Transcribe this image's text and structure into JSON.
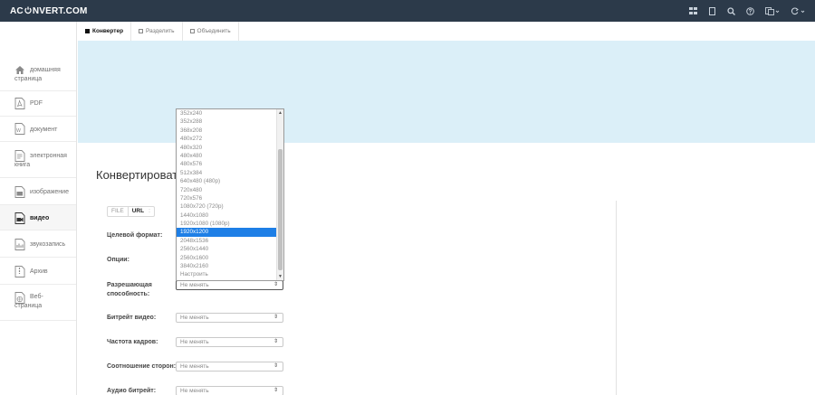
{
  "brand": {
    "text_before": "AC",
    "text_after": "NVERT.COM"
  },
  "topbar": {
    "icons": [
      {
        "name": "apps-grid-icon"
      },
      {
        "name": "bookmark-icon"
      },
      {
        "name": "search-icon"
      },
      {
        "name": "help-icon"
      },
      {
        "name": "language-icon"
      },
      {
        "name": "refresh-icon"
      }
    ]
  },
  "sidebar": {
    "items": [
      {
        "id": "home",
        "label_line1": "домашняя",
        "label_line2": "страница",
        "icon": "home-icon"
      },
      {
        "id": "pdf",
        "label_line1": "PDF",
        "icon": "pdf-icon"
      },
      {
        "id": "document",
        "label_line1": "документ",
        "icon": "document-icon"
      },
      {
        "id": "ebook",
        "label_line1": "электронная",
        "label_line2": "книга",
        "icon": "ebook-icon"
      },
      {
        "id": "image",
        "label_line1": "изображение",
        "icon": "image-icon"
      },
      {
        "id": "video",
        "label_line1": "видео",
        "icon": "video-icon"
      },
      {
        "id": "audio",
        "label_line1": "звукозапись",
        "icon": "audio-icon"
      },
      {
        "id": "archive",
        "label_line1": "Архив",
        "icon": "archive-icon"
      },
      {
        "id": "webpage",
        "label_line1": "Веб-",
        "label_line2": "страница",
        "icon": "webpage-icon"
      }
    ]
  },
  "tabs": [
    {
      "label": "Конвертер",
      "active": true
    },
    {
      "label": "Разделить",
      "active": false
    },
    {
      "label": "Объединить",
      "active": false
    }
  ],
  "main": {
    "heading": "Конвертировать",
    "source_toggle": {
      "file": "FILE",
      "url": "URL",
      "sep": ":"
    },
    "fields": [
      {
        "label": "Целевой формат:"
      },
      {
        "label": "Опции:"
      },
      {
        "label_line1": "Разрешающая",
        "label_line2": "способность:",
        "value": "Не менять"
      },
      {
        "label": "Битрейт видео:",
        "value": "Не менять"
      },
      {
        "label": "Частота кадров:",
        "value": "Не менять"
      },
      {
        "label": "Соотношение сторон:",
        "value": "Не менять"
      },
      {
        "label": "Аудио битрейт:",
        "value": "Не менять"
      }
    ]
  },
  "resolution_dropdown": {
    "options": [
      "352x240",
      "352x288",
      "368x208",
      "480x272",
      "480x320",
      "480x480",
      "480x576",
      "512x384",
      "640x480 (480p)",
      "720x480",
      "720x576",
      "1080x720 (720p)",
      "1440x1080",
      "1920x1080 (1080p)",
      "1920x1200",
      "2048x1536",
      "2560x1440",
      "2560x1600",
      "3840x2160",
      "Настроить"
    ],
    "selected": "1920x1200"
  },
  "colors": {
    "topbar": "#2c3a4a",
    "banner": "#dbeff8",
    "selection": "#1e7fe6"
  }
}
